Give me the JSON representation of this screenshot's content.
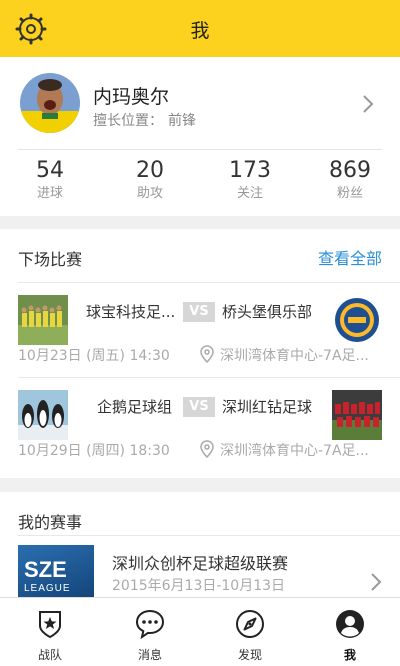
{
  "header": {
    "title": "我",
    "settings_icon": "gear-icon"
  },
  "profile": {
    "name": "内玛奥尔",
    "position_label": "擅长位置：",
    "position_value": "前锋",
    "stats": [
      {
        "value": "54",
        "label": "进球"
      },
      {
        "value": "20",
        "label": "助攻"
      },
      {
        "value": "173",
        "label": "关注"
      },
      {
        "value": "869",
        "label": "粉丝"
      }
    ]
  },
  "next_matches": {
    "title": "下场比赛",
    "view_all": "查看全部",
    "vs_label": "VS",
    "matches": [
      {
        "home": "球宝科技足...",
        "away": "桥头堡俱乐部",
        "time": "10月23日 (周五) 14:30",
        "venue": "深圳湾体育中心-7A足..."
      },
      {
        "home": "企鹅足球组",
        "away": "深圳红钻足球",
        "time": "10月29日 (周四) 18:30",
        "venue": "深圳湾体育中心-7A足..."
      }
    ]
  },
  "my_events": {
    "title": "我的赛事",
    "logo_text": "SZE",
    "logo_subtext": "LEAGUE",
    "event_name": "深圳众创杯足球超级联赛",
    "event_dates": "2015年6月13日-10月13日"
  },
  "tabbar": {
    "tabs": [
      {
        "label": "战队",
        "icon": "team-badge-icon"
      },
      {
        "label": "消息",
        "icon": "chat-bubble-icon"
      },
      {
        "label": "发现",
        "icon": "compass-icon"
      },
      {
        "label": "我",
        "icon": "user-icon",
        "active": true
      }
    ]
  },
  "colors": {
    "accent": "#fdd21e",
    "link": "#2b8fd8"
  }
}
